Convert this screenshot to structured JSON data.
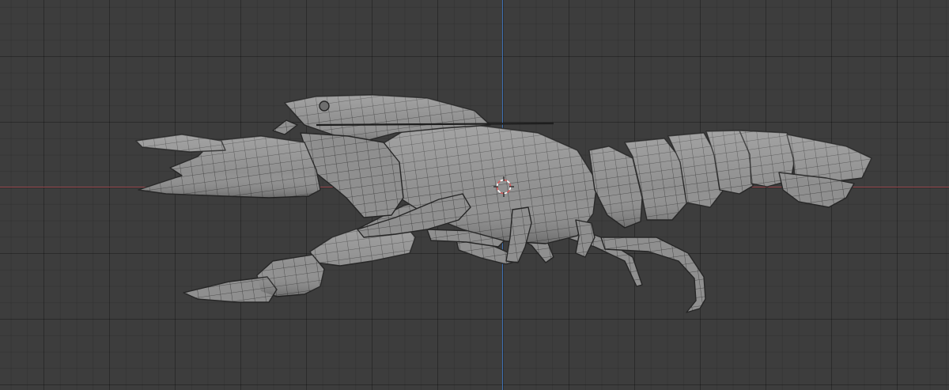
{
  "viewport": {
    "background_color": "#3d3d3d",
    "grid_color": "#2f2f2f",
    "axis_x_color": "#9a4a50",
    "axis_z_color": "#3f6fb0",
    "mesh_fill": "#8c8c8c",
    "mesh_wire": "#3a3a3a",
    "view": "orthographic-side"
  },
  "object": {
    "icon": "crayfish-mesh-icon",
    "selected": false
  },
  "cursor": {
    "icon": "3d-cursor-icon",
    "color_primary": "#d65a5a",
    "color_secondary": "#ffffff"
  }
}
